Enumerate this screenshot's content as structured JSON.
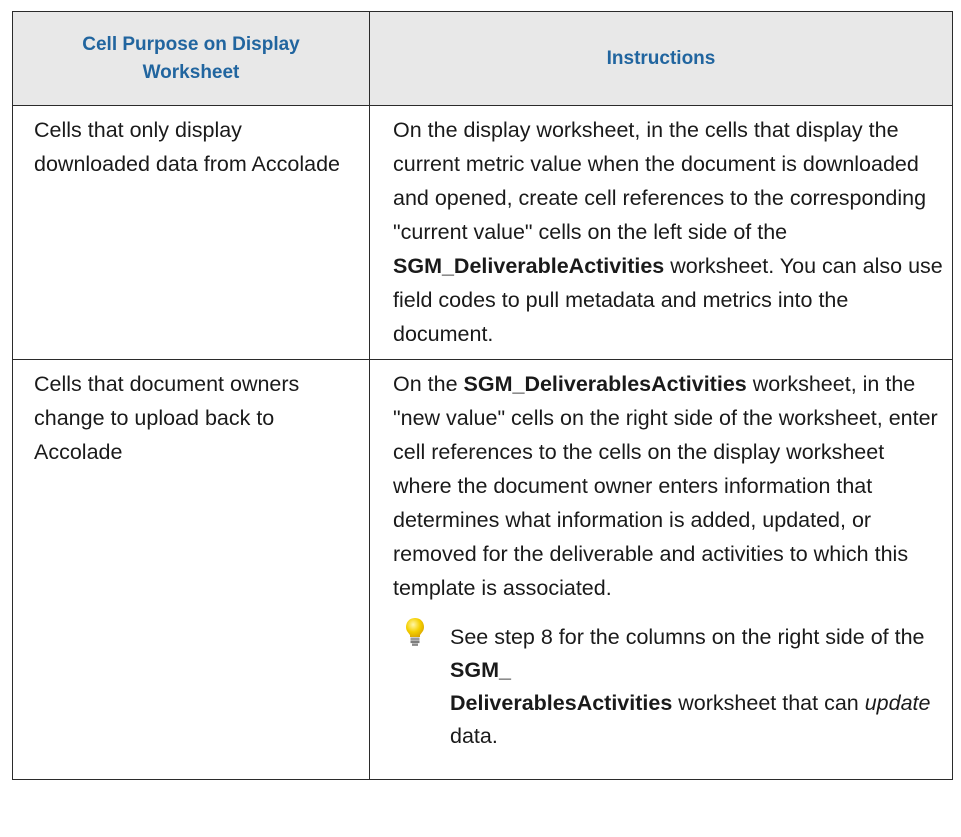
{
  "table": {
    "headers": {
      "purpose": "Cell Purpose on Display Worksheet",
      "instructions": "Instructions"
    },
    "row1": {
      "purpose": "Cells that only display downloaded data from Accolade",
      "instr_part1": "On the display worksheet, in the cells that display the current metric value when the document is downloaded and opened, create cell references to the corresponding \"current value\" cells on the left side of the ",
      "instr_bold": "SGM_DeliverableActivities",
      "instr_part2": " worksheet. You can also use field codes to pull metadata and metrics into the document."
    },
    "row2": {
      "purpose": "Cells that document owners change to upload back to Accolade",
      "instr_part1": "On the ",
      "instr_bold": "SGM_DeliverablesActivities",
      "instr_part2": " worksheet, in the \"new value\" cells on the right side of the worksheet, enter cell references to the cells on the display worksheet where the document owner enters information that determines what information is added, updated, or removed for the deliverable and activities to which this template is associated.",
      "tip": {
        "icon": "lightbulb-icon",
        "part1": "See step 8 for the columns on the right side of the ",
        "bold1": "SGM_",
        "bold2": "DeliverablesActivities",
        "part2": " worksheet that can ",
        "italic": "update",
        "part3": " data."
      }
    }
  },
  "colors": {
    "header_text": "#21659f",
    "header_bg": "#e8e8e8",
    "border": "#2b2b2b",
    "bulb": "#f5c400"
  }
}
